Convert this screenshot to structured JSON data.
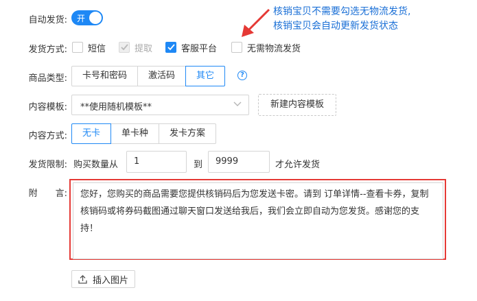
{
  "delivery": {
    "auto_label": "自动发货:",
    "toggle_text": "开",
    "toggle_on": true
  },
  "annotation": {
    "line1": "核销宝贝不需要勾选无物流发货,",
    "line2": "核销宝贝会自动更新发货状态",
    "color": "#1a6fd6"
  },
  "method": {
    "label": "发货方式:",
    "options": [
      {
        "label": "短信",
        "checked": false,
        "disabled": false
      },
      {
        "label": "提取",
        "checked": true,
        "disabled": true
      },
      {
        "label": "客服平台",
        "checked": true,
        "disabled": false
      },
      {
        "label": "无需物流发货",
        "checked": false,
        "disabled": false
      }
    ]
  },
  "product_type": {
    "label": "商品类型:",
    "options": [
      "卡号和密码",
      "激活码",
      "其它"
    ],
    "selected": "其它"
  },
  "template": {
    "label": "内容模板:",
    "value": "**使用随机模板**",
    "new_button": "新建内容模板"
  },
  "content_mode": {
    "label": "内容方式:",
    "options": [
      "无卡",
      "单卡种",
      "发卡方案"
    ],
    "selected": "无卡"
  },
  "limit": {
    "label": "发货限制:",
    "prefix": "购买数量从",
    "min": "1",
    "to": "到",
    "max": "9999",
    "suffix": "才允许发货"
  },
  "note": {
    "label": "附　　言:",
    "text": "您好，您购买的商品需要您提供核销码后为您发送卡密。请到 订单详情--查看卡券，复制核销码或将券码截图通过聊天窗口发送给我后，我们会立即自动为您发货。感谢您的支持！"
  },
  "insert_image": "插入图片",
  "colors": {
    "accent": "#1e88f5",
    "highlight": "#e53935"
  }
}
